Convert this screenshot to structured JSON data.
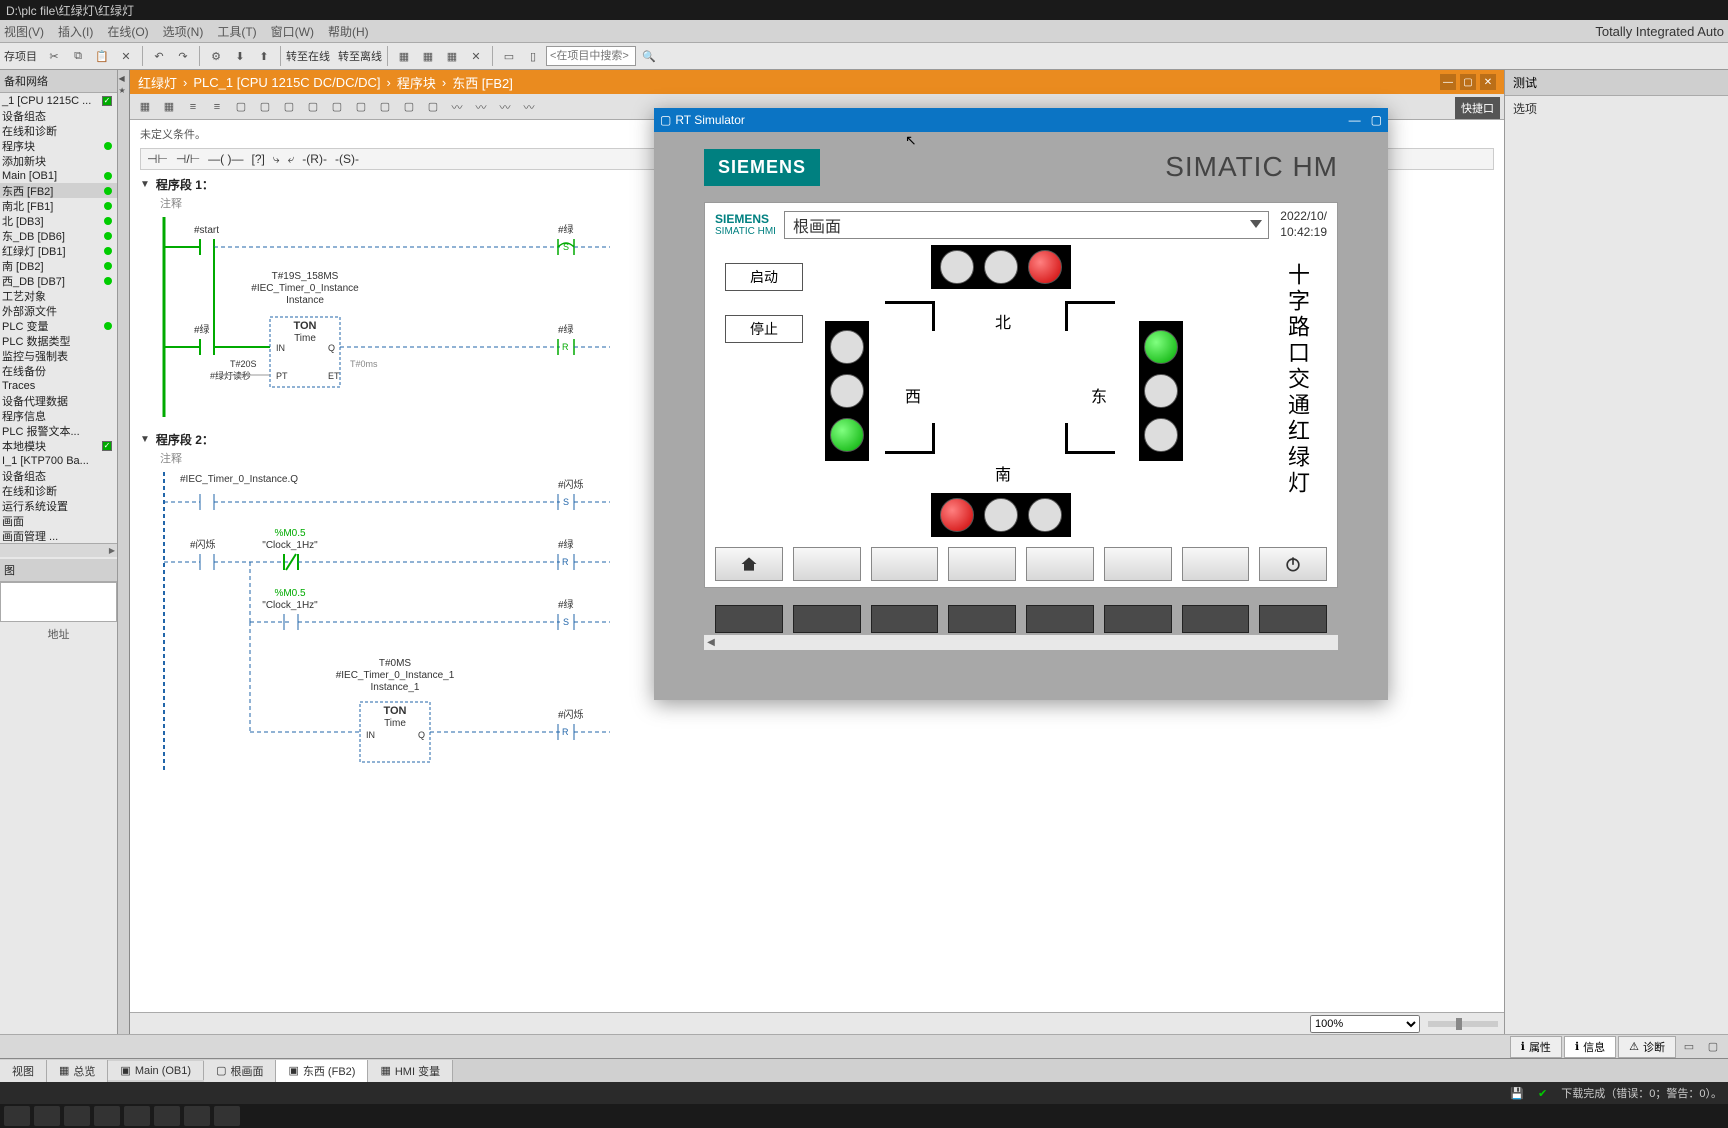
{
  "titlebar": "D:\\plc file\\红绿灯\\红绿灯",
  "menu": {
    "view": "视图(V)",
    "insert": "插入(I)",
    "online": "在线(O)",
    "options": "选项(N)",
    "tools": "工具(T)",
    "window": "窗口(W)",
    "help": "帮助(H)",
    "brand": "Totally Integrated Auto"
  },
  "toolbar": {
    "save": "存项目",
    "gonline": "转至在线",
    "goffline": "转至离线",
    "search_ph": "<在项目中搜索>"
  },
  "breadcrumb": {
    "a": "红绿灯",
    "b": "PLC_1 [CPU 1215C DC/DC/DC]",
    "c": "程序块",
    "d": "东西 [FB2]"
  },
  "tree": {
    "hd": "备和网络",
    "items": [
      {
        "t": "_1 [CPU 1215C ...",
        "chk": true
      },
      {
        "t": "设备组态"
      },
      {
        "t": "在线和诊断"
      },
      {
        "t": "程序块",
        "dot": true
      },
      {
        "t": "添加新块"
      },
      {
        "t": "Main [OB1]",
        "dot": true
      },
      {
        "t": "东西 [FB2]",
        "dot": true,
        "sel": true
      },
      {
        "t": "南北 [FB1]",
        "dot": true
      },
      {
        "t": "北 [DB3]",
        "dot": true
      },
      {
        "t": "东_DB [DB6]",
        "dot": true
      },
      {
        "t": "红绿灯 [DB1]",
        "dot": true
      },
      {
        "t": "南 [DB2]",
        "dot": true
      },
      {
        "t": "西_DB [DB7]",
        "dot": true
      },
      {
        "t": "工艺对象"
      },
      {
        "t": "外部源文件"
      },
      {
        "t": "PLC 变量",
        "dot": true
      },
      {
        "t": "PLC 数据类型"
      },
      {
        "t": "监控与强制表"
      },
      {
        "t": "在线备份"
      },
      {
        "t": "Traces"
      },
      {
        "t": "设备代理数据"
      },
      {
        "t": "程序信息"
      },
      {
        "t": "PLC 报警文本..."
      },
      {
        "t": "本地模块",
        "chk": true
      },
      {
        "t": "I_1 [KTP700 Ba..."
      },
      {
        "t": "设备组态"
      },
      {
        "t": "在线和诊断"
      },
      {
        "t": "运行系统设置"
      },
      {
        "t": "画面"
      },
      {
        "t": "画面管理 ..."
      }
    ],
    "imghd": "图",
    "addr": "地址"
  },
  "editor": {
    "cond": "未定义条件。",
    "quick": "快捷口",
    "net1": "程序段 1：",
    "net2": "程序段 2：",
    "comment": "注释",
    "n1": {
      "start": "#start",
      "green": "#绿",
      "tmrName": "T#19S_158MS",
      "tmrInst": "#IEC_Timer_0_Instance",
      "ton": "TON",
      "time": "Time",
      "in": "IN",
      "q": "Q",
      "pt": "PT",
      "et": "ET",
      "t20": "T#20S",
      "ptlbl": "#绿灯读秒",
      "etval": "T#0ms"
    },
    "n2": {
      "iecq": "#IEC_Timer_0_Instance.Q",
      "flash": "#闪烁",
      "m05": "%M0.5",
      "clk": "\"Clock_1Hz\"",
      "green": "#绿",
      "tmr1": "#IEC_Timer_0_Instance_1",
      "t0": "T#0MS",
      "ton": "TON",
      "time": "Time",
      "in": "IN",
      "q": "Q"
    }
  },
  "zoom": "100%",
  "props": {
    "p": "属性",
    "i": "信息",
    "d": "诊断"
  },
  "right": {
    "test": "测试",
    "opt": "选项"
  },
  "rt": {
    "title": "RT Simulator",
    "brand": "SIEMENS",
    "brandtxt": "SIMATIC HM",
    "sub1": "SIEMENS",
    "sub2": "SIMATIC HMI",
    "screen": "根画面",
    "date": "2022/10/",
    "time": "10:42:19",
    "start": "启动",
    "stop": "停止",
    "north": "北",
    "south": "南",
    "east": "东",
    "west": "西",
    "vtitle": "十字路口交通红绿灯"
  },
  "bottom": {
    "view": "视图",
    "overview": "总览",
    "main": "Main (OB1)",
    "root": "根画面",
    "ew": "东西 (FB2)",
    "hmi": "HMI 变量"
  },
  "status": {
    "dl": "下载完成（错误：0；警告：0）。"
  }
}
